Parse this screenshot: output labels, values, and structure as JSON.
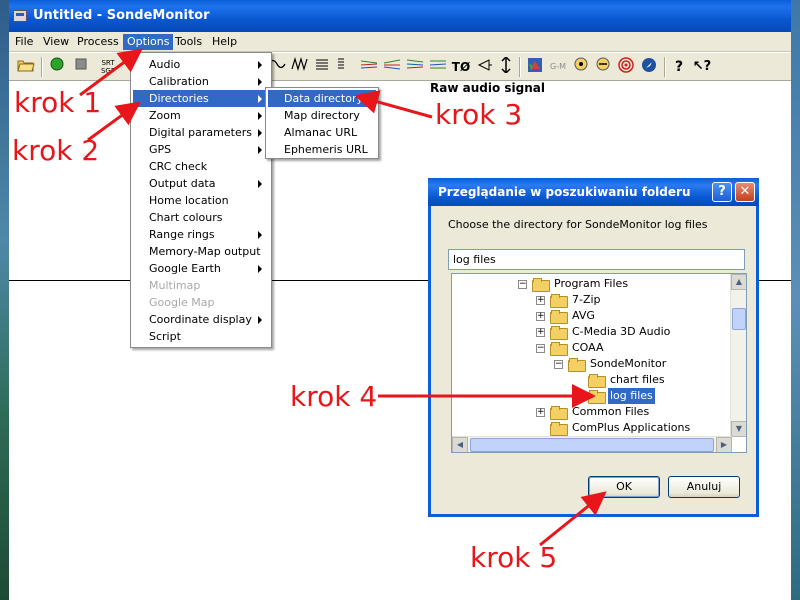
{
  "window": {
    "title": "Untitled - SondeMonitor"
  },
  "menubar": {
    "items": [
      "File",
      "View",
      "Process",
      "Options",
      "Tools",
      "Help"
    ]
  },
  "toolbar": {
    "srt_label": "SRT\nSGP",
    "gm_label": "G-M",
    "t0_label": "TØ"
  },
  "main": {
    "signal_label": "Raw audio signal"
  },
  "options_menu": {
    "items": [
      {
        "label": "Audio",
        "submenu": true
      },
      {
        "label": "Calibration",
        "submenu": true
      },
      {
        "label": "Directories",
        "submenu": true,
        "highlighted": true
      },
      {
        "label": "Zoom",
        "submenu": true
      },
      {
        "label": "Digital parameters",
        "submenu": true
      },
      {
        "label": "GPS",
        "submenu": true
      },
      {
        "label": "CRC check"
      },
      {
        "label": "Output data",
        "submenu": true
      },
      {
        "label": "Home location"
      },
      {
        "label": "Chart colours"
      },
      {
        "label": "Range rings",
        "submenu": true
      },
      {
        "label": "Memory-Map output"
      },
      {
        "label": "Google Earth",
        "submenu": true
      },
      {
        "label": "Multimap",
        "disabled": true
      },
      {
        "label": "Google Map",
        "disabled": true
      },
      {
        "label": "Coordinate display",
        "submenu": true
      },
      {
        "label": "Script"
      }
    ]
  },
  "directories_submenu": {
    "items": [
      {
        "label": "Data directory",
        "highlighted": true
      },
      {
        "label": "Map directory"
      },
      {
        "label": "Almanac URL"
      },
      {
        "label": "Ephemeris URL"
      }
    ]
  },
  "dialog": {
    "title": "Przeglądanie w poszukiwaniu folderu",
    "description": "Choose the directory for SondeMonitor log files",
    "input_value": "log files",
    "ok_label": "OK",
    "cancel_label": "Anuluj",
    "help_glyph": "?",
    "close_glyph": "✕",
    "tree": [
      {
        "label": "Program Files",
        "level": 0,
        "expander": "−"
      },
      {
        "label": "7-Zip",
        "level": 1,
        "expander": "+"
      },
      {
        "label": "AVG",
        "level": 1,
        "expander": "+"
      },
      {
        "label": "C-Media 3D Audio",
        "level": 1,
        "expander": "+"
      },
      {
        "label": "COAA",
        "level": 1,
        "expander": "−"
      },
      {
        "label": "SondeMonitor",
        "level": 2,
        "expander": "−"
      },
      {
        "label": "chart files",
        "level": 3,
        "expander": ""
      },
      {
        "label": "log files",
        "level": 3,
        "expander": "",
        "selected": true
      },
      {
        "label": "Common Files",
        "level": 1,
        "expander": "+"
      },
      {
        "label": "ComPlus Applications",
        "level": 1,
        "expander": ""
      }
    ]
  },
  "annotations": [
    "krok 1",
    "krok 2",
    "krok 3",
    "krok 4",
    "krok 5"
  ],
  "colors": {
    "annotation": "#e8161a",
    "selection": "#316ac5",
    "titlebar": "#0a5fd8"
  }
}
